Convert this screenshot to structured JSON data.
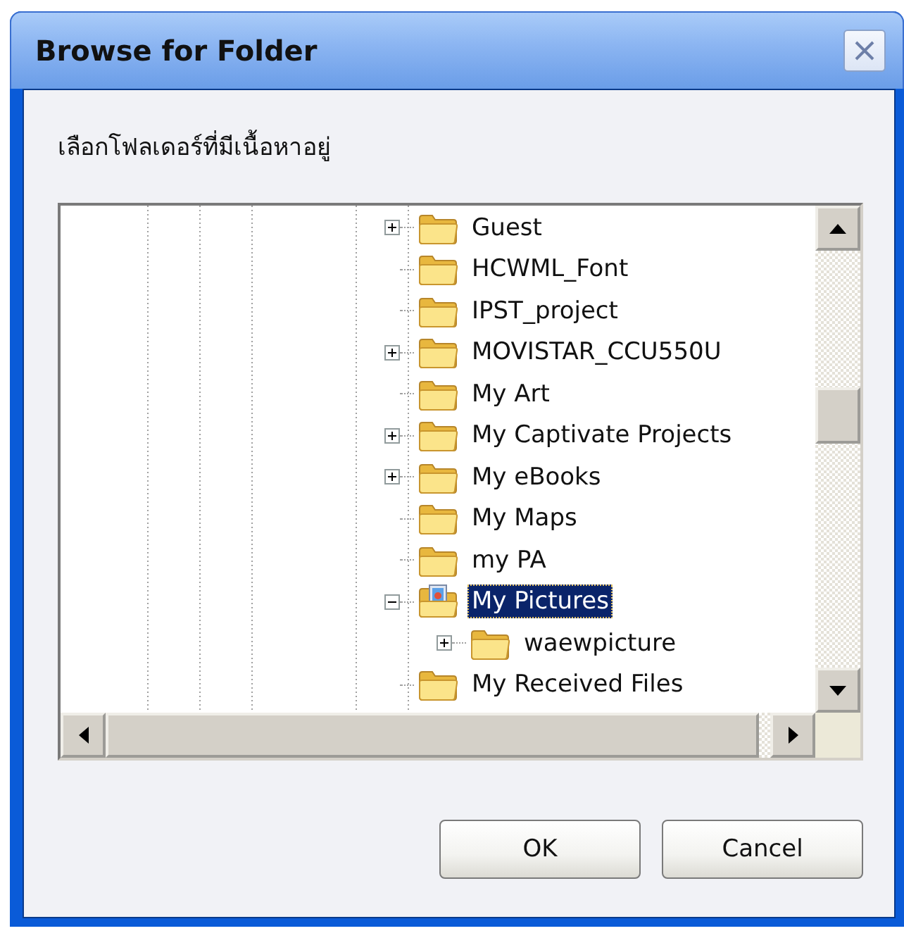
{
  "window": {
    "title": "Browse for Folder"
  },
  "prompt": "เลือกโฟลเดอร์ที่มีเนื้อหาอยู่",
  "tree": [
    {
      "label": "Guest",
      "kind": "folder",
      "expanded": false,
      "selected": false
    },
    {
      "label": "HCWML_Font",
      "kind": "folder",
      "selected": false
    },
    {
      "label": "IPST_project",
      "kind": "folder",
      "selected": false
    },
    {
      "label": "MOVISTAR_CCU550U",
      "kind": "folder",
      "expanded": false,
      "selected": false
    },
    {
      "label": "My Art",
      "kind": "folder",
      "selected": false
    },
    {
      "label": "My Captivate Projects",
      "kind": "folder",
      "expanded": false,
      "selected": false
    },
    {
      "label": "My eBooks",
      "kind": "folder",
      "expanded": false,
      "selected": false
    },
    {
      "label": "My Maps",
      "kind": "folder",
      "selected": false
    },
    {
      "label": "my PA",
      "kind": "folder",
      "selected": false
    },
    {
      "label": "My Pictures",
      "kind": "pictures",
      "expanded": true,
      "selected": true,
      "children": [
        {
          "label": "waewpicture",
          "kind": "folder",
          "expanded": false,
          "selected": false
        }
      ]
    },
    {
      "label": "My Received Files",
      "kind": "folder",
      "selected": false
    }
  ],
  "buttons": [
    "OK",
    "Cancel"
  ]
}
